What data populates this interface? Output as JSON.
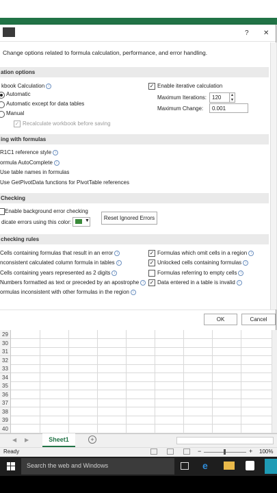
{
  "dialog": {
    "help_glyph": "?",
    "close_glyph": "✕",
    "description": "Change options related to formula calculation, performance, and error handling."
  },
  "sections": {
    "calc_options": "ation options",
    "working_formulas": "ing with formulas",
    "error_checking": "Checking",
    "error_rules": "checking rules"
  },
  "calc": {
    "workbook_calc_label": "kbook Calculation",
    "automatic": "Automatic",
    "automatic_except": "Automatic except for data tables",
    "manual": "Manual",
    "recalc_before_save": "Recalculate workbook before saving",
    "enable_iterative": "Enable iterative calculation",
    "max_iterations_label": "Maximum Iterations:",
    "max_iterations_value": "120",
    "max_change_label": "Maximum Change:",
    "max_change_value": "0.001"
  },
  "working": {
    "r1c1": "R1C1 reference style",
    "autocomplete": "ormula AutoComplete",
    "table_names": "Use table names in formulas",
    "getpivot": "Use GetPivotData functions for PivotTable references"
  },
  "errcheck": {
    "enable_bg": "Enable background error checking",
    "indicate_color": "dicate errors using this color:",
    "reset_button": "Reset Ignored Errors"
  },
  "rules": {
    "left": [
      "Cells containing formulas that result in an error",
      "nconsistent calculated column formula in tables",
      "Cells containing years represented as 2 digits",
      "Numbers formatted as text or preceded by an apostrophe",
      "ormulas inconsistent with other formulas in the region"
    ],
    "right": [
      "Formulas which omit cells in a region",
      "Unlocked cells containing formulas",
      "Formulas referring to empty cells",
      "Data entered in a table is invalid"
    ]
  },
  "footer": {
    "ok": "OK",
    "cancel": "Cancel"
  },
  "grid": {
    "rows": [
      "29",
      "30",
      "31",
      "32",
      "33",
      "34",
      "35",
      "36",
      "37",
      "38",
      "39",
      "40"
    ]
  },
  "tabs": {
    "sheet": "Sheet1",
    "add": "+"
  },
  "status": {
    "ready": "Ready",
    "zoom": "100%",
    "minus": "−",
    "plus": "+"
  },
  "taskbar": {
    "search": "Search the web and Windows"
  }
}
